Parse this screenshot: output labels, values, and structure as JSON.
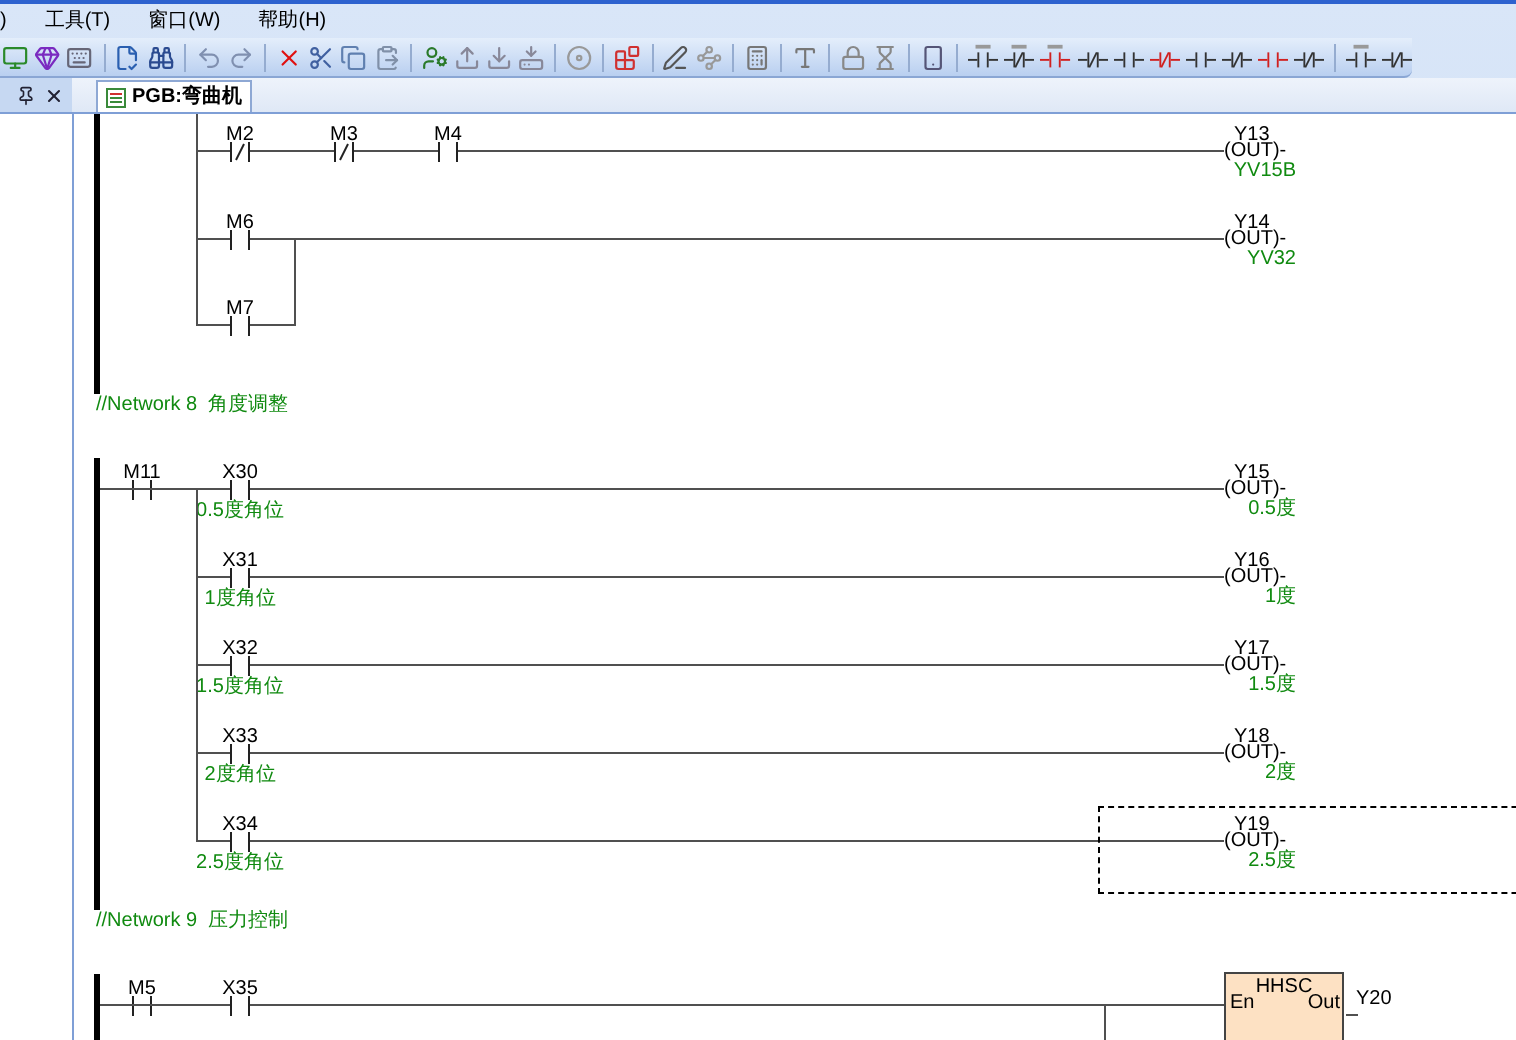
{
  "menu": [
    {
      "label": ")"
    },
    {
      "label": "工具(T)"
    },
    {
      "label": "窗口(W)"
    },
    {
      "label": "帮助(H)"
    }
  ],
  "tabs": [
    {
      "label": "PGB:弯曲机",
      "selected": true
    }
  ],
  "networks": [
    {
      "kind": "continued",
      "rows": [
        {
          "contacts": [
            {
              "address": "M2",
              "kind": "normally_closed"
            },
            {
              "address": "M3",
              "kind": "normally_closed"
            },
            {
              "address": "M4",
              "kind": "normally_open"
            }
          ],
          "output": {
            "kind": "coil",
            "address": "Y13",
            "symbol": "(OUT)-",
            "comment": "YV15B",
            "selected": false
          }
        },
        {
          "contacts": [
            {
              "address": "M6",
              "kind": "normally_open"
            }
          ],
          "parallel": [
            {
              "address": "M7",
              "kind": "normally_open"
            }
          ],
          "output": {
            "kind": "coil",
            "address": "Y14",
            "symbol": "(OUT)-",
            "comment": "YV32",
            "selected": false
          }
        }
      ]
    },
    {
      "kind": "full",
      "comment": "//Network 8  角度调整",
      "prefix": [
        {
          "address": "M11",
          "kind": "normally_open"
        }
      ],
      "rows": [
        {
          "contacts": [
            {
              "address": "X30",
              "kind": "normally_open",
              "comment": "0.5度角位"
            }
          ],
          "output": {
            "kind": "coil",
            "address": "Y15",
            "symbol": "(OUT)-",
            "comment": "0.5度",
            "selected": false
          }
        },
        {
          "contacts": [
            {
              "address": "X31",
              "kind": "normally_open",
              "comment": "1度角位"
            }
          ],
          "output": {
            "kind": "coil",
            "address": "Y16",
            "symbol": "(OUT)-",
            "comment": "1度",
            "selected": false
          }
        },
        {
          "contacts": [
            {
              "address": "X32",
              "kind": "normally_open",
              "comment": "1.5度角位"
            }
          ],
          "output": {
            "kind": "coil",
            "address": "Y17",
            "symbol": "(OUT)-",
            "comment": "1.5度",
            "selected": false
          }
        },
        {
          "contacts": [
            {
              "address": "X33",
              "kind": "normally_open",
              "comment": "2度角位"
            }
          ],
          "output": {
            "kind": "coil",
            "address": "Y18",
            "symbol": "(OUT)-",
            "comment": "2度",
            "selected": false
          }
        },
        {
          "contacts": [
            {
              "address": "X34",
              "kind": "normally_open",
              "comment": "2.5度角位"
            }
          ],
          "output": {
            "kind": "coil",
            "address": "Y19",
            "symbol": "(OUT)-",
            "comment": "2.5度",
            "selected": true
          }
        }
      ]
    },
    {
      "kind": "full",
      "comment": "//Network 9  压力控制",
      "prefix": [
        {
          "address": "M5",
          "kind": "normally_open"
        }
      ],
      "rows": [
        {
          "contacts": [
            {
              "address": "X35",
              "kind": "normally_open"
            }
          ],
          "branch_below": true,
          "output": {
            "kind": "block",
            "name": "HHSC",
            "input": "En",
            "output_pin": "Out",
            "address": "Y20",
            "selected": false
          }
        }
      ]
    }
  ]
}
